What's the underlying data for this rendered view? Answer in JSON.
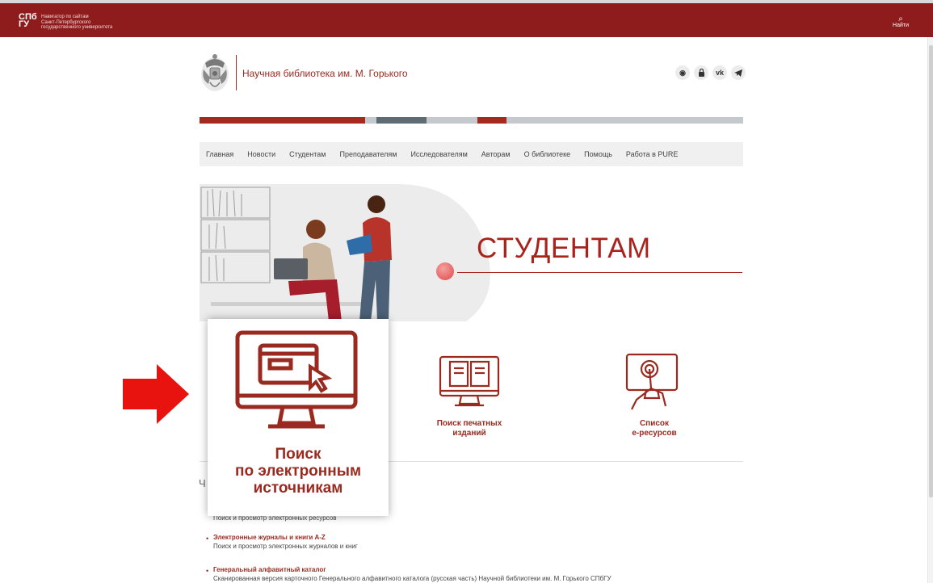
{
  "topbar": {
    "logo_line1": "СПб",
    "logo_line2": "ГУ",
    "tagline": "Навигатор по сайтам\nСанкт-Петербургского\nгосударственного университета",
    "search_label": "Найти"
  },
  "header": {
    "title": "Научная библиотека им. М. Горького",
    "social_icons": [
      "eye-icon",
      "lock-icon",
      "vk-icon",
      "telegram-icon"
    ],
    "social_glyphs": [
      "◉",
      "🔒",
      "vk",
      "➤"
    ]
  },
  "colors": {
    "brand_red": "#8f1c1c",
    "accent_red": "#a8231c",
    "bar_red": "#a4291f",
    "bar_slate": "#5f6b73",
    "bar_light": "#c4c9cd"
  },
  "nav": {
    "items": [
      "Главная",
      "Новости",
      "Студентам",
      "Преподавателям",
      "Исследователям",
      "Авторам",
      "О библиотеке",
      "Помощь",
      "Работа в PURE"
    ]
  },
  "hero": {
    "title": "СТУДЕНТАМ"
  },
  "services": {
    "print_search": "Поиск печатных\nизданий",
    "eresources": "Список\nе-ресурсов",
    "popout_label": "Поиск\nпо электронным\nисточникам"
  },
  "list": {
    "section_letter": "Ч",
    "items": [
      {
        "title": "",
        "desc": "Поиск и просмотр электронных ресурсов"
      },
      {
        "title": "Электронные журналы и книги A-Z",
        "desc": "Поиск и просмотр электронных журналов и книг"
      },
      {
        "title": "Генеральный алфавитный каталог",
        "desc": "Сканированная версия карточного Генерального алфавитного каталога (русская часть) Научной библиотеки им. М. Горького СПбГУ"
      }
    ]
  }
}
